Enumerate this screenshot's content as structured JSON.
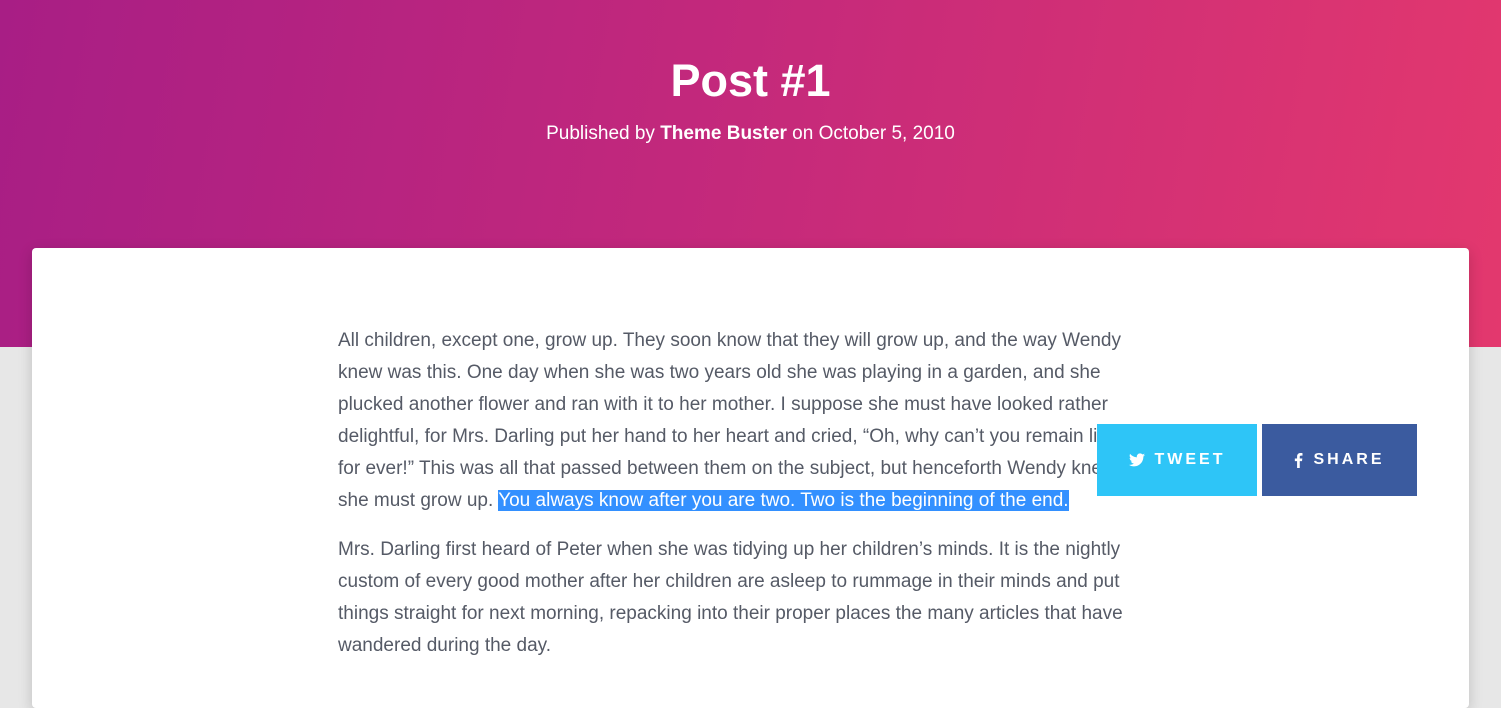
{
  "header": {
    "title": "Post #1",
    "meta_prefix": "Published by ",
    "author": "Theme Buster",
    "meta_middle": " on ",
    "date": "October 5, 2010"
  },
  "content": {
    "paragraph1_text": "All children, except one, grow up. They soon know that they will grow up, and the way Wendy knew was this. One day when she was two years old she was playing in a garden, and she plucked another flower and ran with it to her mother. I suppose she must have looked rather delightful, for Mrs. Darling put her hand to her heart and cried, “Oh, why can’t you remain like this for ever!” This was all that passed between them on the subject, but henceforth Wendy knew that she must grow up. ",
    "paragraph1_highlight": "You always know after you are two. Two is the beginning of the end.",
    "paragraph2": "Mrs. Darling first heard of Peter when she was tidying up her children’s minds. It is the nightly custom of every good mother after her children are asleep to rummage in their minds and put things straight for next morning, repacking into their proper places the many articles that have wandered during the day."
  },
  "share": {
    "tweet_label": "TWEET",
    "share_label": "SHARE",
    "tweet_icon": "twitter-icon",
    "share_icon": "facebook-icon"
  },
  "colors": {
    "hero_start": "#a81e85",
    "hero_end": "#e3386e",
    "tweet": "#2ec5f7",
    "facebook": "#3b5b9f",
    "highlight": "#3390ff"
  }
}
